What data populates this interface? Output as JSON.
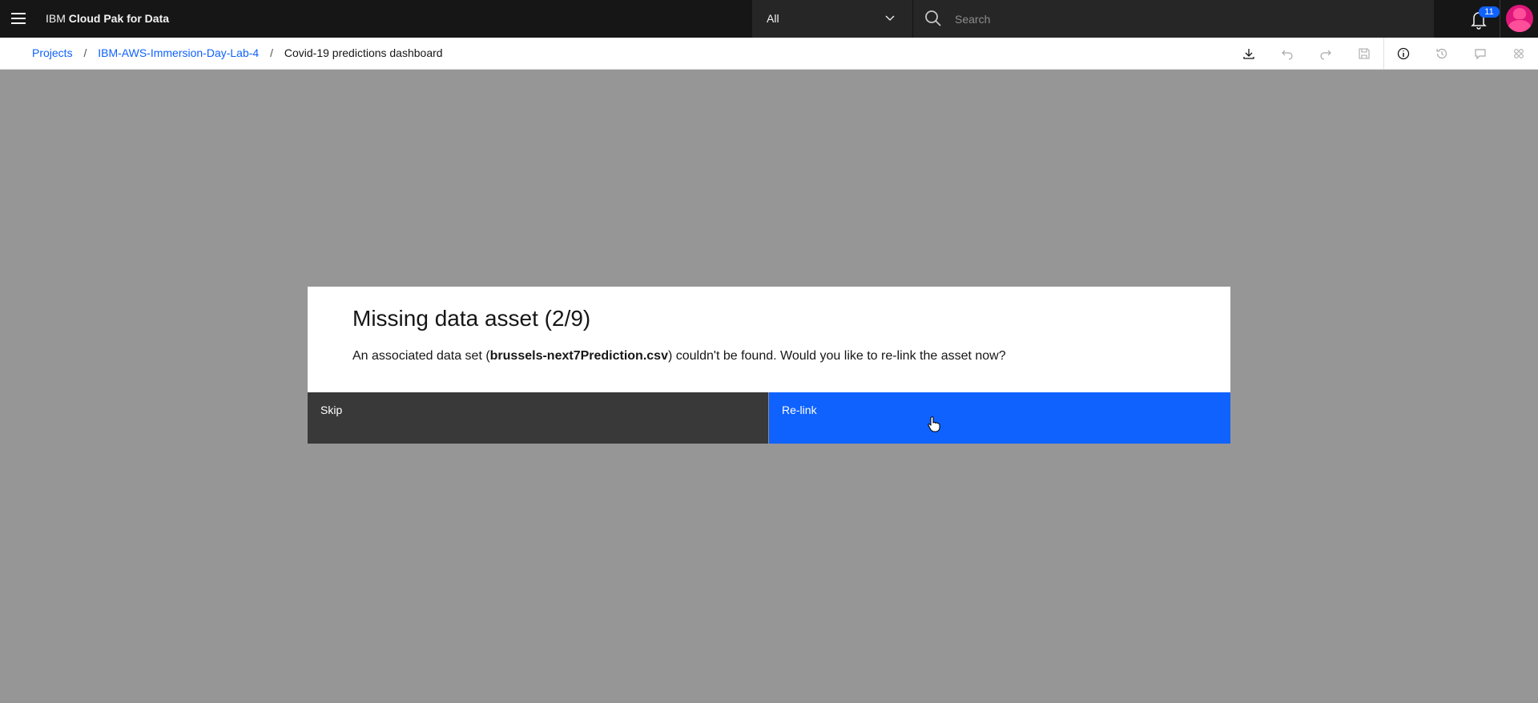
{
  "header": {
    "brand_prefix": "IBM",
    "brand_name": "Cloud Pak for Data",
    "scope_value": "All",
    "search_placeholder": "Search",
    "notification_count": "11"
  },
  "breadcrumb": {
    "items": [
      "Projects",
      "IBM-AWS-Immersion-Day-Lab-4"
    ],
    "current": "Covid-19 predictions dashboard",
    "separator": "/"
  },
  "toolbar": {
    "icons": [
      "download-icon",
      "undo-icon",
      "redo-icon",
      "save-icon",
      "info-icon",
      "history-icon",
      "comment-icon",
      "collaborators-icon"
    ]
  },
  "modal": {
    "title": "Missing data asset (2/9)",
    "message_prefix": "An associated data set (",
    "file_name": "brussels-next7Prediction.csv",
    "message_suffix": ") couldn't be found. Would you like to re-link the asset now?",
    "skip_label": "Skip",
    "relink_label": "Re-link"
  },
  "colors": {
    "header_bg": "#161616",
    "accent": "#0f62fe",
    "overlay": "#969696",
    "secondary_button": "#393939",
    "avatar": "#e0177a"
  }
}
